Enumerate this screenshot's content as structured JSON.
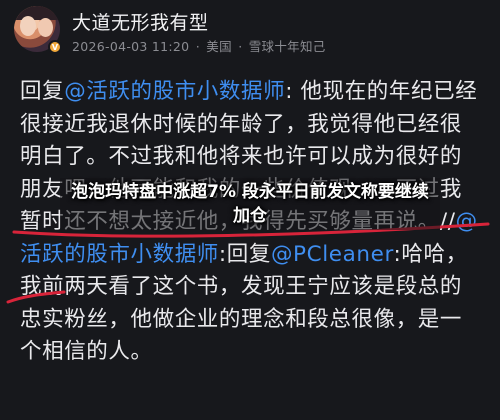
{
  "post": {
    "author": "大道无形我有型",
    "date": "2026-04-03 11:20",
    "sep": "·",
    "location": "美国",
    "source": "雪球十年知己",
    "badge": "V",
    "body": [
      {
        "t": "回复",
        "c": false
      },
      {
        "t": "@活跃的股市小数据师",
        "c": true
      },
      {
        "t": ": 他现在的年纪已经很接近我退休时候的年龄了，我觉得他已经很明白了。不过我和他将来也许可以成为很好的朋友吧，他可能和我的一些价值观……不过我暂时还不想太接近他，我得先买够量再说。//",
        "c": false
      },
      {
        "t": "@活跃的股市小数据师",
        "c": true
      },
      {
        "t": ":回复",
        "c": false
      },
      {
        "t": "@PCleaner",
        "c": true
      },
      {
        "t": ":哈哈，我前两天看了这个书，发现王宁应该是段总的忠实粉丝，他做企业的理念和段总很像，是一个相信的人。",
        "c": false
      }
    ]
  },
  "overlay": {
    "headline": "泡泡玛特盘中涨超7% 段永平日前发文称要继续加仓"
  },
  "colors": {
    "background": "#17181c",
    "mention": "#3f8ef0",
    "annotation": "#d8243a"
  }
}
